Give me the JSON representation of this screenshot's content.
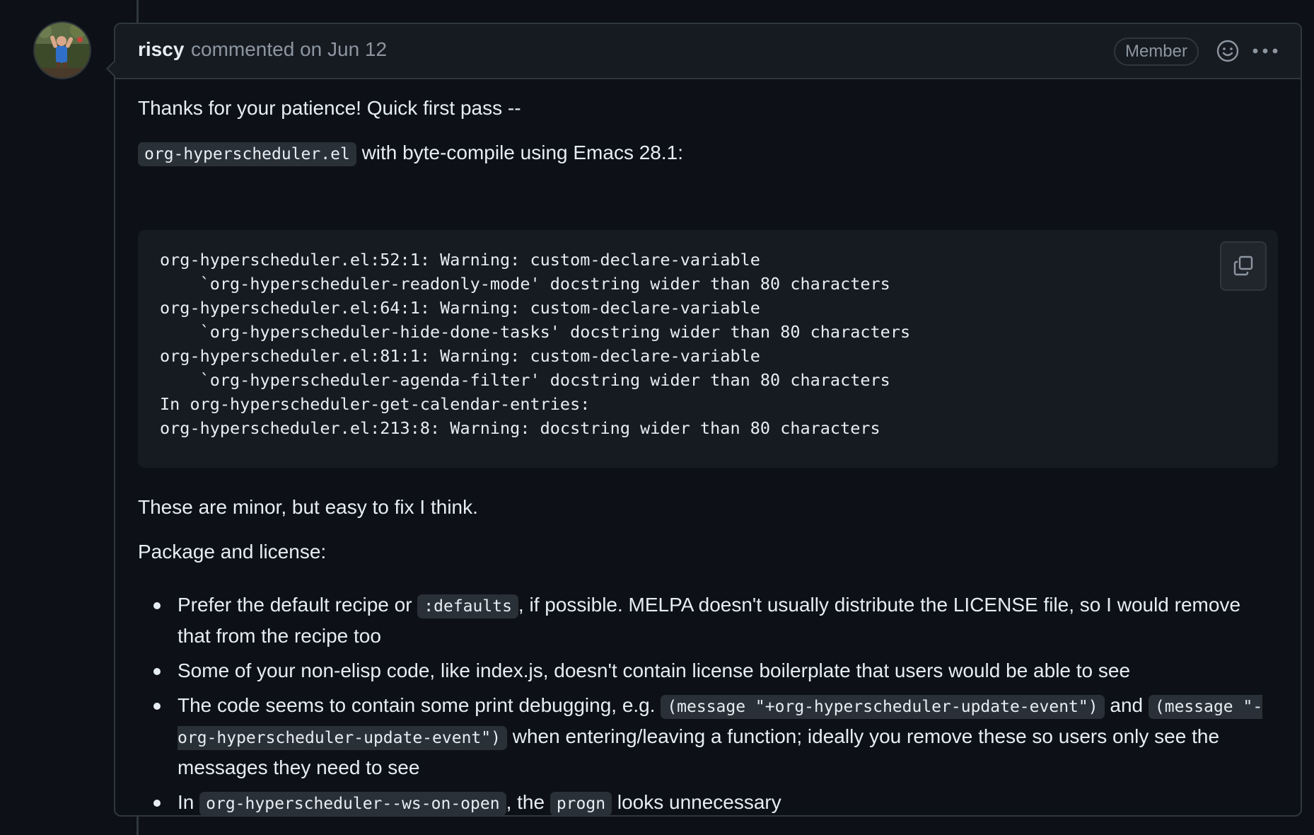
{
  "comment": {
    "author": "riscy",
    "action": "commented on Jun 12",
    "role_badge": "Member",
    "icons": {
      "avatar": "user-avatar",
      "reaction": "smiley-icon",
      "more": "kebab-horizontal-icon",
      "copy": "copy-icon"
    },
    "body": {
      "intro": "Thanks for your patience! Quick first pass --",
      "compile_file": "org-hyperscheduler.el",
      "compile_text": " with byte-compile using Emacs 28.1:",
      "code_block": "org-hyperscheduler.el:52:1: Warning: custom-declare-variable\n    `org-hyperscheduler-readonly-mode' docstring wider than 80 characters\norg-hyperscheduler.el:64:1: Warning: custom-declare-variable\n    `org-hyperscheduler-hide-done-tasks' docstring wider than 80 characters\norg-hyperscheduler.el:81:1: Warning: custom-declare-variable\n    `org-hyperscheduler-agenda-filter' docstring wider than 80 characters\nIn org-hyperscheduler-get-calendar-entries:\norg-hyperscheduler.el:213:8: Warning: docstring wider than 80 characters",
      "minor_note": "These are minor, but easy to fix I think.",
      "package_heading": "Package and license:",
      "items": [
        {
          "pre": "Prefer the default recipe or ",
          "code": ":defaults",
          "post": ", if possible. MELPA doesn't usually distribute the LICENSE file, so I would remove that from the recipe too"
        },
        {
          "text": "Some of your non-elisp code, like index.js, doesn't contain license boilerplate that users would be able to see"
        },
        {
          "pre": "The code seems to contain some print debugging, e.g. ",
          "code1": "(message \"+org-hyperscheduler-update-event\")",
          "mid": " and ",
          "code2": "(message \"-org-hyperscheduler-update-event\")",
          "post": " when entering/leaving a function; ideally you remove these so users only see the messages they need to see"
        },
        {
          "pre": "In ",
          "code1": "org-hyperscheduler--ws-on-open",
          "mid": ", the ",
          "code2": "progn",
          "post": " looks unnecessary"
        }
      ]
    }
  },
  "colors": {
    "background": "#0d1117",
    "header_bg": "#161b22",
    "border": "#30363d",
    "text": "#e6edf3",
    "muted": "#8d96a0",
    "code_bg": "#2a3038"
  }
}
